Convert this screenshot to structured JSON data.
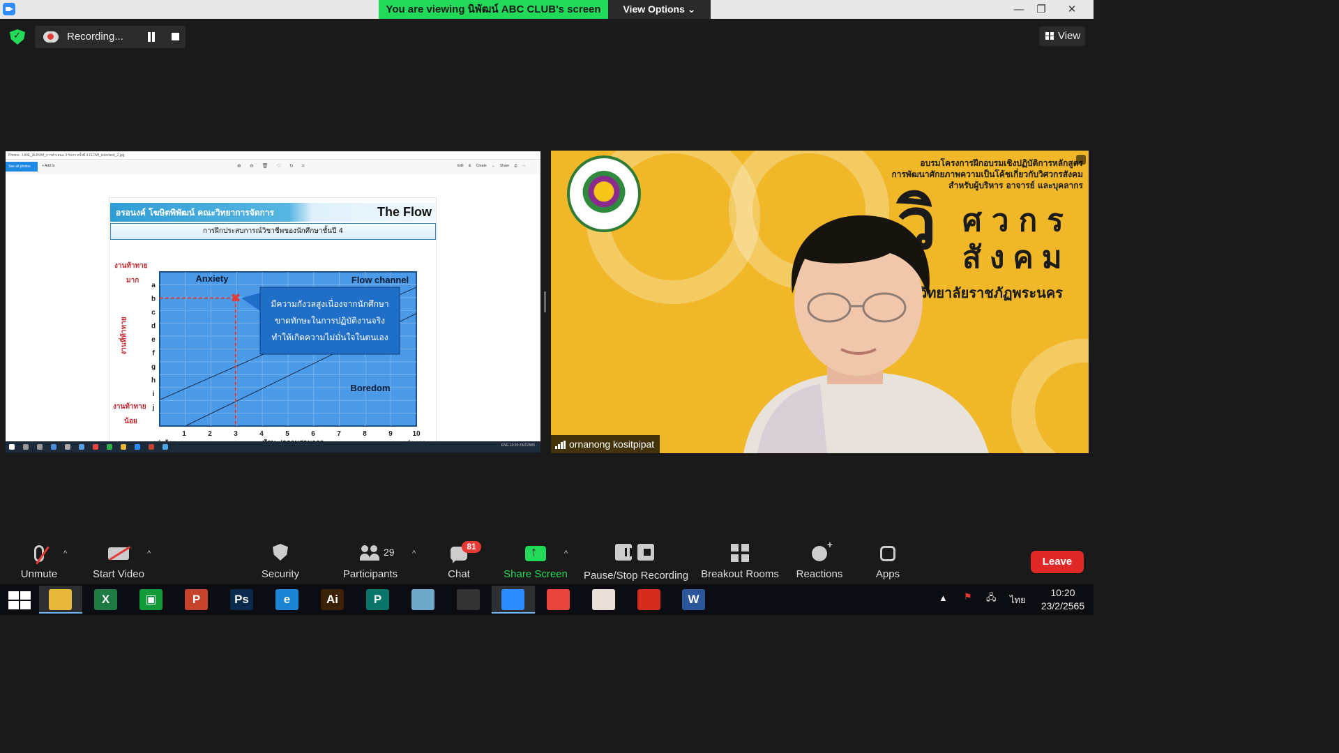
{
  "titlebar": {
    "viewing_text": "You are viewing นิพัฒน์ ABC CLUB's screen",
    "view_options": "View Options ⌄",
    "minimize": "—",
    "restore": "❐",
    "close": "✕"
  },
  "meeting_top": {
    "recording_label": "Recording...",
    "view_label": "View"
  },
  "shared_screen": {
    "window_title": "Photos - LINE_ALBUM_การนำเสนอ 3 รับกร ครั้งที่ 4  FLOW_teleclient_2.jpg",
    "see_all_photos": "See all photos",
    "add_to": "+ Add to",
    "edit_create": "Edit & Create ⌄",
    "share": "Share",
    "tray_text": "ENG  10:20  23/2/2565",
    "slide": {
      "author": "อรอนงค์ โฆษิตพิพัฒน์ คณะวิทยาการจัดการ",
      "title": "The Flow",
      "subtitle": "การฝึกประสบการณ์วิชาชีพของนักศึกษาชั้นปี 4",
      "high_challenge_1": "งานท้าทาย",
      "high_challenge_2": "มาก",
      "low_challenge_1": "งานท้าทาย",
      "low_challenge_2": "น้อย",
      "challenge_axis": "งานที่ท้าทาย"
    }
  },
  "chart_data": {
    "type": "line",
    "title": "The Flow",
    "xlabel": "ทักษะ/ความสามารถ",
    "x_low_label": "เก่งน้อย",
    "x_high_label": "เก่งมาก",
    "categories": [
      "1",
      "2",
      "3",
      "4",
      "5",
      "6",
      "7",
      "8",
      "9",
      "10"
    ],
    "y_tick_labels": [
      "a",
      "b",
      "c",
      "d",
      "e",
      "f",
      "g",
      "h",
      "i",
      "j"
    ],
    "regions": [
      "Anxiety",
      "Flow channel",
      "Boredom"
    ],
    "marker": {
      "x": 3,
      "y": "b"
    },
    "callout": [
      "มีความกังวลสูงเนื่องจากนักศึกษา",
      "ขาดทักษะในการปฏิบัติงานจริง",
      "ทำให้เกิดความไม่มั่นใจในตนเอง"
    ],
    "grid": true,
    "colors": {
      "plot": "#4a9ae8",
      "marker": "#e53935",
      "callout": "#1f6fc9"
    }
  },
  "video": {
    "banner_line1": "อบรมโครงการฝึกอบรมเชิงปฏิบัติการหลักสูตร",
    "banner_line2": "การพัฒนาศักยภาพความเป็นโค้ชเกี่ยวกับวิศวกรสังคม",
    "banner_line3": "สำหรับผู้บริหาร อาจารย์ และบุคลากร",
    "big_wi": "วิ",
    "big_row1": "ศวกร",
    "big_row2": "สังคม",
    "college": "วิทยาลัยราชภัฏพระนคร",
    "participant_name": "ornanong kositpipat"
  },
  "toolbar": {
    "unmute": "Unmute",
    "start_video": "Start Video",
    "security": "Security",
    "participants": "Participants",
    "participants_count": "29",
    "chat": "Chat",
    "chat_badge": "81",
    "share_screen": "Share Screen",
    "pause_stop": "Pause/Stop Recording",
    "breakout": "Breakout Rooms",
    "reactions": "Reactions",
    "apps": "Apps",
    "leave": "Leave",
    "caret": "^"
  },
  "taskbar": {
    "apps": [
      {
        "name": "File Explorer",
        "glyph": "",
        "color": "#e8b83a"
      },
      {
        "name": "Excel",
        "glyph": "X",
        "color": "#1d7a42"
      },
      {
        "name": "Store",
        "glyph": "▣",
        "color": "#0f9b3a"
      },
      {
        "name": "PowerPoint",
        "glyph": "P",
        "color": "#c5432a"
      },
      {
        "name": "Photoshop",
        "glyph": "Ps",
        "color": "#0c2a4e"
      },
      {
        "name": "Internet Explorer",
        "glyph": "e",
        "color": "#1b84d3"
      },
      {
        "name": "Illustrator",
        "glyph": "Ai",
        "color": "#3b2106"
      },
      {
        "name": "Publisher",
        "glyph": "P",
        "color": "#077568"
      },
      {
        "name": "Notepad",
        "glyph": "",
        "color": "#6fa8c8"
      },
      {
        "name": "PhotoScape",
        "glyph": "",
        "color": "#333333"
      },
      {
        "name": "Zoom",
        "glyph": "",
        "color": "#2d8cff"
      },
      {
        "name": "Chrome",
        "glyph": "",
        "color": "#e8453c"
      },
      {
        "name": "Photos",
        "glyph": "",
        "color": "#e9e0d8"
      },
      {
        "name": "Acrobat",
        "glyph": "",
        "color": "#d62b1f"
      },
      {
        "name": "Word",
        "glyph": "W",
        "color": "#2b579a"
      }
    ],
    "lang": "ไทย",
    "time": "10:20",
    "date": "23/2/2565"
  }
}
